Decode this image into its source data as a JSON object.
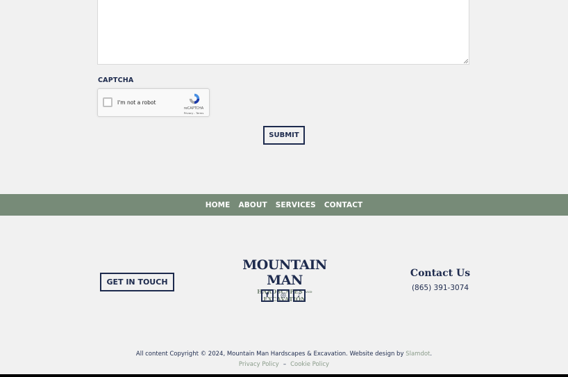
{
  "form": {
    "message_value": "",
    "captcha_label": "CAPTCHA",
    "recaptcha": {
      "checkbox_label": "I'm not a robot",
      "brand": "reCAPTCHA",
      "terms": "Privacy - Terms"
    },
    "submit_label": "SUBMIT"
  },
  "nav": {
    "items": [
      {
        "label": "HOME"
      },
      {
        "label": "ABOUT"
      },
      {
        "label": "SERVICES"
      },
      {
        "label": "CONTACT"
      }
    ]
  },
  "footer": {
    "get_in_touch_label": "GET IN TOUCH",
    "logo": {
      "main": "MOUNTAIN MAN",
      "sub_left": "HARDSCAPES",
      "sub_and": "AND",
      "sub_right": "EXCAVATION"
    },
    "socials": [
      {
        "name": "facebook",
        "glyph": "f"
      },
      {
        "name": "instagram",
        "glyph": "◎"
      },
      {
        "name": "tiktok",
        "glyph": "♪"
      }
    ],
    "contact_title": "Contact Us",
    "phone": "(865) 391-3074",
    "copyright_text": "All content Copyright © 2024, Mountain Man Hardscapes & Excavation. Website design by ",
    "designer_link": "Slamdot",
    "copyright_end": ".",
    "privacy_policy": "Privacy Policy",
    "separator": "–",
    "cookie_policy": "Cookie Policy"
  },
  "colors": {
    "navy": "#1d2a4d",
    "sage": "#778b78",
    "background": "#f1f1f1"
  }
}
